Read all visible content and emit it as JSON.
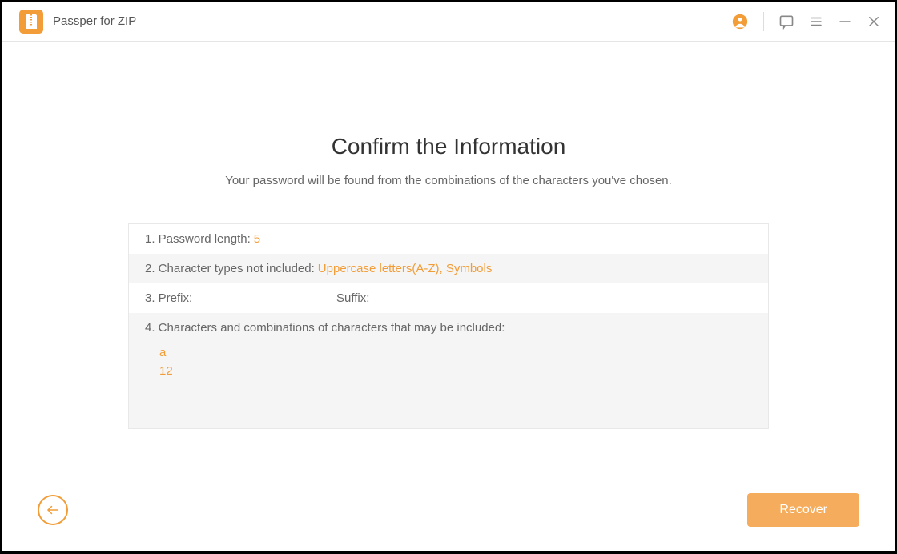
{
  "app": {
    "title": "Passper for ZIP"
  },
  "main": {
    "heading": "Confirm the Information",
    "subtitle": "Your password will be found from the combinations of the characters you've chosen.",
    "rows": {
      "length_label": "1. Password length:",
      "length_value": "5",
      "not_included_label": "2. Character types not included:",
      "not_included_value": "Uppercase letters(A-Z), Symbols",
      "prefix_label": "3. Prefix:",
      "suffix_label": "Suffix:",
      "combos_label": "4. Characters and combinations of characters that may be included:",
      "combo_line1": "a",
      "combo_line2": "12"
    }
  },
  "footer": {
    "recover_label": "Recover"
  }
}
